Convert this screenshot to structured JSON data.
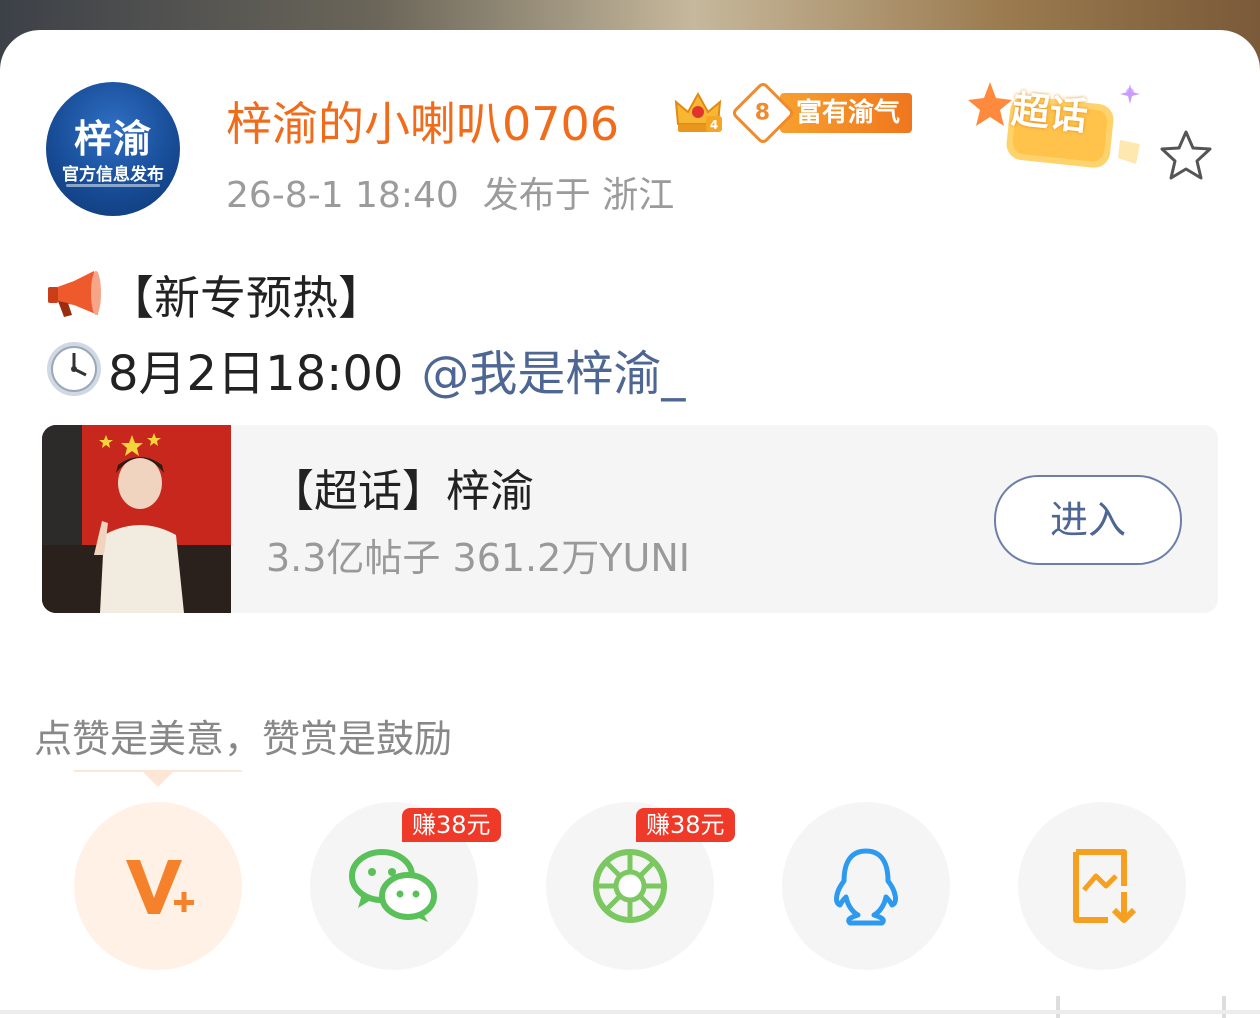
{
  "user": {
    "name": "梓渝的小喇叭0706",
    "avatar_main": "梓渝",
    "avatar_sub": "官方信息发布",
    "level_number": "8",
    "level_title": "富有渝气",
    "crown_level": "4"
  },
  "post_meta": {
    "date": "26-8-1 18:40",
    "location": "发布于 浙江"
  },
  "badges": {
    "super_topic": "超话"
  },
  "content": {
    "line1_text": "【新专预热】",
    "line2_text": "8月2日18:00",
    "mention": "@我是梓渝_"
  },
  "topic_card": {
    "title": "【超话】梓渝",
    "stats": "3.3亿帖子 361.2万YUNI",
    "button_label": "进入"
  },
  "reward_hint": "点赞是美意，赞赏是鼓励",
  "share": {
    "earn_label": "赚38元",
    "icons": [
      "v-plus-icon",
      "wechat-icon",
      "moments-icon",
      "qq-icon",
      "save-image-icon"
    ]
  },
  "colors": {
    "username": "#f06b1a",
    "mention": "#4e6693",
    "earn_badge": "#ef3a2a",
    "wechat": "#5ac05a",
    "moments": "#7bc860",
    "qq": "#2d9af0",
    "save": "#f5a020",
    "v_plus": "#f5822a"
  }
}
